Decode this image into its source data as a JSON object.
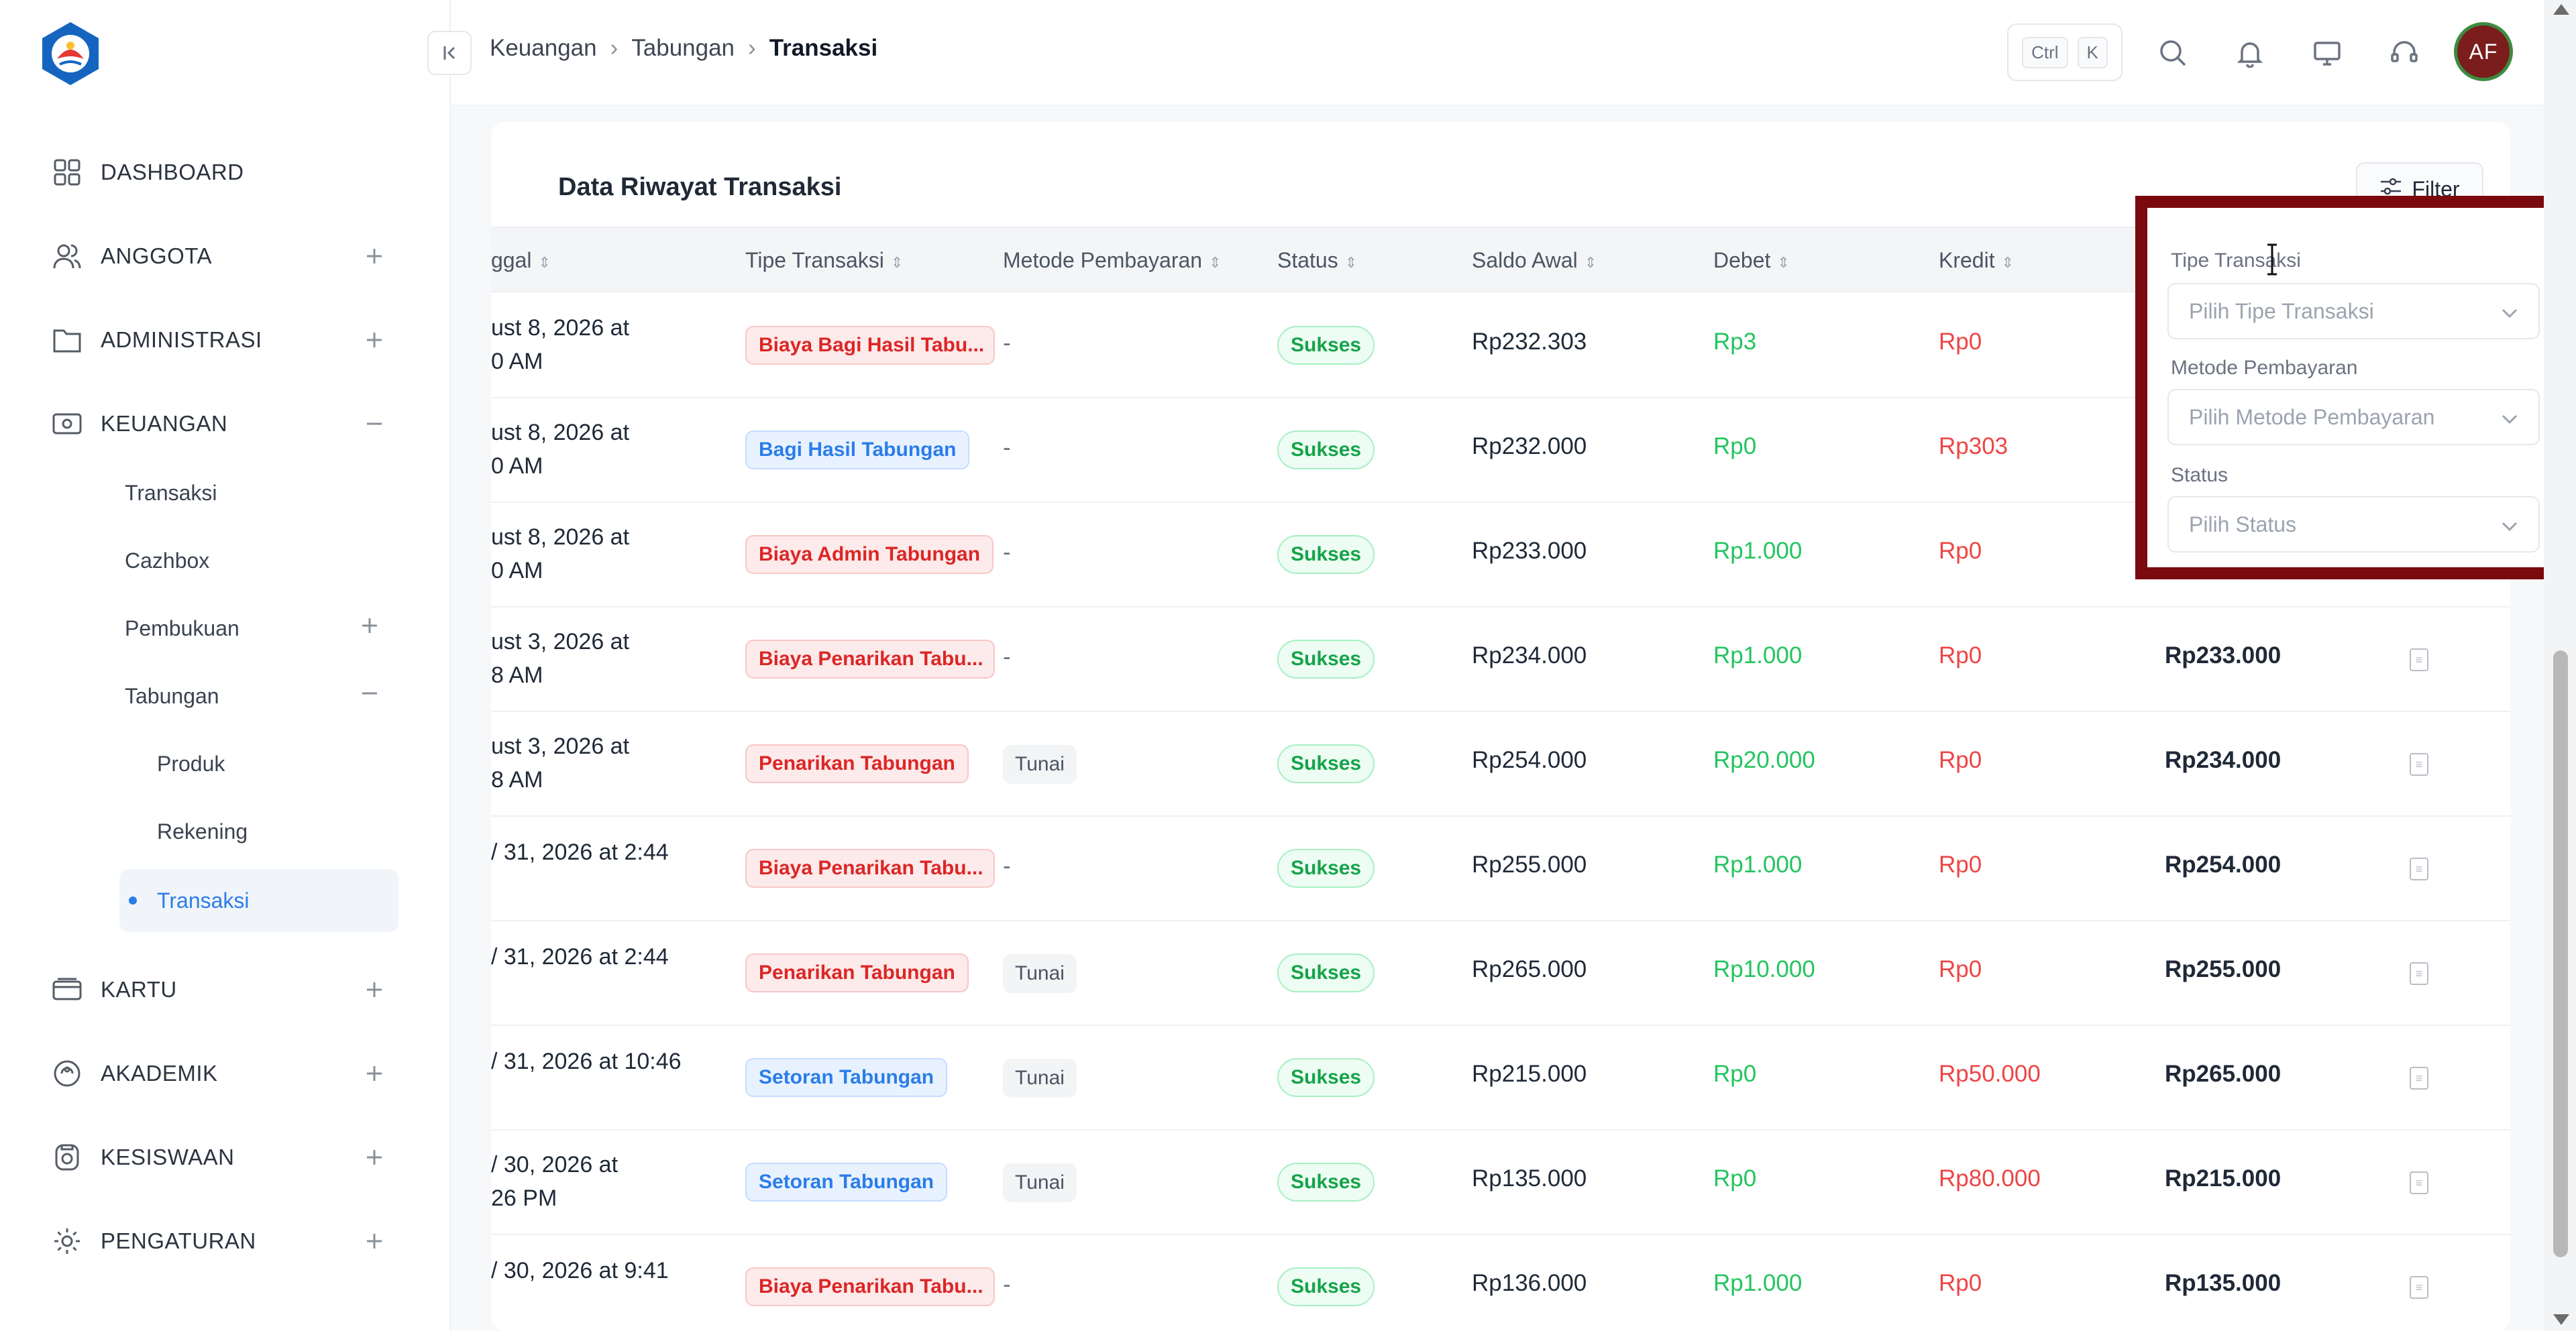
{
  "sidebar": {
    "items": [
      {
        "label": "DASHBOARD",
        "icon": "dashboard-grid-icon"
      },
      {
        "label": "ANGGOTA",
        "icon": "users-icon"
      },
      {
        "label": "ADMINISTRASI",
        "icon": "folder-icon"
      },
      {
        "label": "KEUANGAN",
        "icon": "money-icon"
      },
      {
        "label": "KARTU",
        "icon": "card-icon"
      },
      {
        "label": "AKADEMIK",
        "icon": "academic-icon"
      },
      {
        "label": "KESISWAAN",
        "icon": "student-icon"
      },
      {
        "label": "PENGATURAN",
        "icon": "gear-icon"
      }
    ],
    "keuangan_sub": [
      "Transaksi",
      "Cazhbox",
      "Pembukuan",
      "Tabungan"
    ],
    "tabungan_sub": [
      "Produk",
      "Rekening",
      "Transaksi"
    ]
  },
  "header": {
    "breadcrumb": [
      "Keuangan",
      "Tabungan",
      "Transaksi"
    ],
    "shortcut": {
      "ctrl": "Ctrl",
      "key": "K"
    },
    "avatar_initials": "AF"
  },
  "card": {
    "title": "Data Riwayat Transaksi",
    "filter_label": "Filter"
  },
  "table": {
    "columns": [
      "ggal",
      "Tipe Transaksi",
      "Metode Pembayaran",
      "Status",
      "Saldo Awal",
      "Debet",
      "Kredit"
    ],
    "rows": [
      {
        "date1": "ust 8, 2026 at",
        "date2": "0 AM",
        "type": "Biaya Bagi Hasil Tabu...",
        "type_color": "red",
        "method": "-",
        "status": "Sukses",
        "saldo_awal": "Rp232.303",
        "debet": "Rp3",
        "kredit": "Rp0",
        "saldo_akhir": ""
      },
      {
        "date1": "ust 8, 2026 at",
        "date2": "0 AM",
        "type": "Bagi Hasil Tabungan",
        "type_color": "blue",
        "method": "-",
        "status": "Sukses",
        "saldo_awal": "Rp232.000",
        "debet": "Rp0",
        "kredit": "Rp303",
        "saldo_akhir": ""
      },
      {
        "date1": "ust 8, 2026 at",
        "date2": "0 AM",
        "type": "Biaya Admin Tabungan",
        "type_color": "red",
        "method": "-",
        "status": "Sukses",
        "saldo_awal": "Rp233.000",
        "debet": "Rp1.000",
        "kredit": "Rp0",
        "saldo_akhir": ""
      },
      {
        "date1": "ust 3, 2026 at",
        "date2": "8 AM",
        "type": "Biaya Penarikan Tabu...",
        "type_color": "red",
        "method": "-",
        "status": "Sukses",
        "saldo_awal": "Rp234.000",
        "debet": "Rp1.000",
        "kredit": "Rp0",
        "saldo_akhir": "Rp233.000"
      },
      {
        "date1": "ust 3, 2026 at",
        "date2": "8 AM",
        "type": "Penarikan Tabungan",
        "type_color": "red",
        "method": "Tunai",
        "status": "Sukses",
        "saldo_awal": "Rp254.000",
        "debet": "Rp20.000",
        "kredit": "Rp0",
        "saldo_akhir": "Rp234.000"
      },
      {
        "date1": "/ 31, 2026 at 2:44",
        "date2": "",
        "type": "Biaya Penarikan Tabu...",
        "type_color": "red",
        "method": "-",
        "status": "Sukses",
        "saldo_awal": "Rp255.000",
        "debet": "Rp1.000",
        "kredit": "Rp0",
        "saldo_akhir": "Rp254.000"
      },
      {
        "date1": "/ 31, 2026 at 2:44",
        "date2": "",
        "type": "Penarikan Tabungan",
        "type_color": "red",
        "method": "Tunai",
        "status": "Sukses",
        "saldo_awal": "Rp265.000",
        "debet": "Rp10.000",
        "kredit": "Rp0",
        "saldo_akhir": "Rp255.000"
      },
      {
        "date1": "/ 31, 2026 at 10:46",
        "date2": "",
        "type": "Setoran Tabungan",
        "type_color": "blue",
        "method": "Tunai",
        "status": "Sukses",
        "saldo_awal": "Rp215.000",
        "debet": "Rp0",
        "kredit": "Rp50.000",
        "saldo_akhir": "Rp265.000"
      },
      {
        "date1": "/ 30, 2026 at",
        "date2": "26 PM",
        "type": "Setoran Tabungan",
        "type_color": "blue",
        "method": "Tunai",
        "status": "Sukses",
        "saldo_awal": "Rp135.000",
        "debet": "Rp0",
        "kredit": "Rp80.000",
        "saldo_akhir": "Rp215.000"
      },
      {
        "date1": "/ 30, 2026 at 9:41",
        "date2": "",
        "type": "Biaya Penarikan Tabu...",
        "type_color": "red",
        "method": "-",
        "status": "Sukses",
        "saldo_awal": "Rp136.000",
        "debet": "Rp1.000",
        "kredit": "Rp0",
        "saldo_akhir": "Rp135.000"
      }
    ]
  },
  "filter_panel": {
    "tipe_label": "Tipe Transaksi",
    "tipe_placeholder": "Pilih Tipe Transaksi",
    "metode_label": "Metode Pembayaran",
    "metode_placeholder": "Pilih Metode Pembayaran",
    "status_label": "Status",
    "status_placeholder": "Pilih Status"
  },
  "colors": {
    "accent": "#2b7de9",
    "highlight_border": "#7a0a0e",
    "success": "#22c55e",
    "danger": "#ef4444"
  }
}
